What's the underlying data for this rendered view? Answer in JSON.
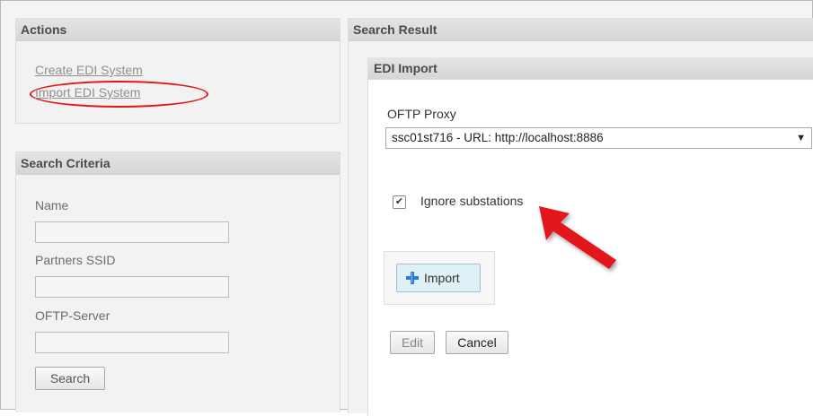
{
  "actions": {
    "title": "Actions",
    "create_link": "Create EDI System",
    "import_link": "Import EDI System"
  },
  "search_criteria": {
    "title": "Search Criteria",
    "name_label": "Name",
    "partners_ssid_label": "Partners SSID",
    "oftp_server_label": "OFTP-Server",
    "search_button": "Search"
  },
  "search_result": {
    "title": "Search Result"
  },
  "edi_import": {
    "title": "EDI Import",
    "oftp_proxy_label": "OFTP Proxy",
    "oftp_proxy_selected": "ssc01st716 - URL: http://localhost:8886",
    "dropdown_arrow": "▼",
    "ignore_substations_label": "Ignore substations",
    "ignore_substations_checked": true,
    "checkmark": "✔",
    "import_button": "Import",
    "edit_button": "Edit",
    "cancel_button": "Cancel"
  },
  "colors": {
    "annotation_red": "#e3151b",
    "import_button_bg": "#dff0f6",
    "plus_icon": "#2b7bd6"
  },
  "icons": {
    "import": "plus-icon",
    "annotation": "red-arrow-icon"
  }
}
